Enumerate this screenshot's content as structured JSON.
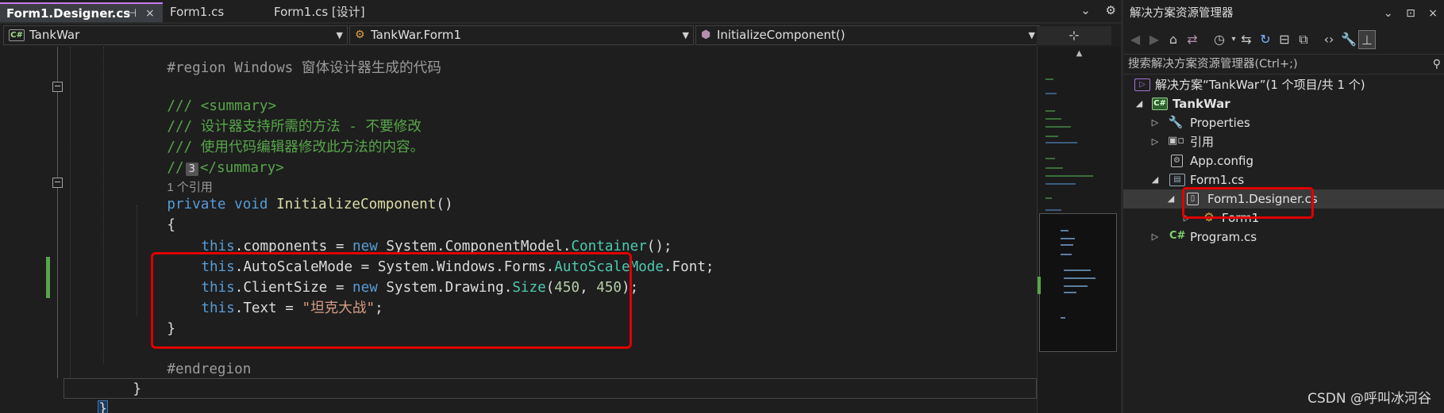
{
  "tabs": [
    {
      "label": "Form1.Designer.cs",
      "active": true
    },
    {
      "label": "Form1.cs",
      "active": false
    },
    {
      "label": "Form1.cs [设计]",
      "active": false
    }
  ],
  "tab_tools": {
    "dropdown": "⌄",
    "settings": "⚙"
  },
  "nav": {
    "project": "TankWar",
    "class": "TankWar.Form1",
    "member": "InitializeComponent()",
    "project_icon": "C#",
    "class_icon": "class-icon",
    "member_icon": "method-icon"
  },
  "split_button": "⊹",
  "code": {
    "region_line": "#region Windows 窗体设计器生成的代码",
    "summary_open": "/// <summary>",
    "summary_line1": "/// 设计器支持所需的方法 - 不要修改",
    "summary_line2": "/// 使用代码编辑器修改此方法的内容。",
    "summary_close_prefix": "//",
    "summary_badge": "3",
    "summary_close": "</summary>",
    "references": "1 个引用",
    "signature": {
      "kw1": "private",
      "kw2": "void",
      "name": "InitializeComponent",
      "parens": "()"
    },
    "open_brace": "{",
    "line_components": {
      "this": "this",
      "mid1": ".components = ",
      "new": "new",
      "ns": " System.ComponentModel.",
      "type": "Container",
      "end": "();"
    },
    "line_autoscale": {
      "this": "this",
      "mid1": ".AutoScaleMode = System.Windows.Forms.",
      "type": "AutoScaleMode",
      "end": ".Font;"
    },
    "line_clientsize": {
      "this": "this",
      "mid1": ".ClientSize = ",
      "new": "new",
      "ns": " System.Drawing.",
      "type": "Size",
      "open": "(",
      "n1": "450",
      "comma": ", ",
      "n2": "450",
      "end": ");"
    },
    "line_text": {
      "this": "this",
      "mid1": ".Text = ",
      "str": "\"坦克大战\"",
      "end": ";"
    },
    "close_brace": "}",
    "endregion": "#endregion",
    "class_close": "}",
    "namespace_close": "}"
  },
  "solution_explorer": {
    "title": "解决方案资源管理器",
    "title_tools": [
      "⌄",
      "⊡",
      "×"
    ],
    "toolbar_icons": [
      "back-icon",
      "forward-icon",
      "home-icon",
      "vs-switch-icon",
      "history-icon",
      "sync-icon",
      "refresh-icon",
      "collapse-icon",
      "show-all-icon",
      "view-code-icon",
      "properties-icon",
      "preview-icon"
    ],
    "search_placeholder": "搜索解决方案资源管理器(Ctrl+;)",
    "search_icon": "⚲",
    "tree": {
      "solution": "解决方案“TankWar”(1 个项目/共 1 个)",
      "project": "TankWar",
      "properties": "Properties",
      "references": "引用",
      "appconfig": "App.config",
      "form1": "Form1.cs",
      "designer": "Form1.Designer.cs",
      "form1_class": "Form1",
      "program": "Program.cs"
    }
  },
  "watermark": "CSDN @呼叫冰河谷",
  "colors": {
    "highlight": "#e00000",
    "keyword": "#569cd6",
    "comment": "#57a64a",
    "type": "#4ec9b0",
    "method": "#dcdcaa",
    "string": "#d69d85",
    "change_marker": "#57a64a"
  }
}
